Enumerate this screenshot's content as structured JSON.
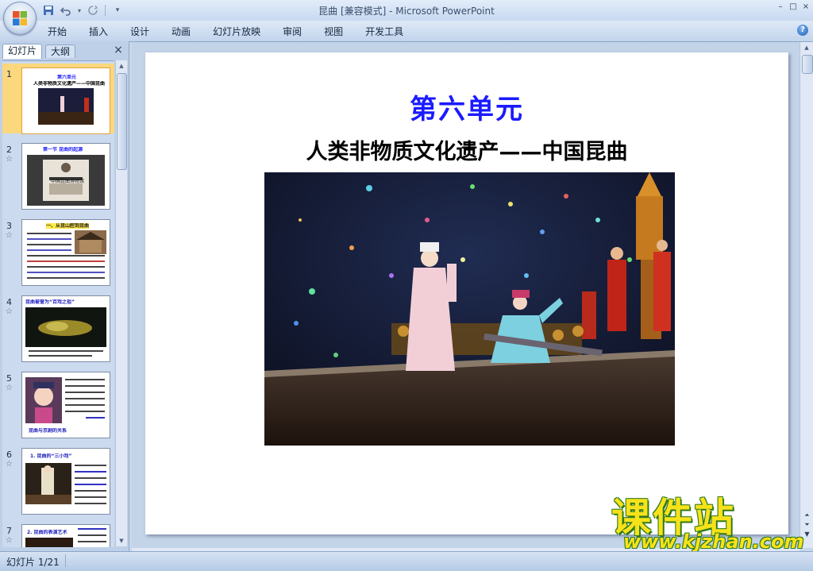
{
  "window": {
    "title": "昆曲 [兼容模式] - Microsoft PowerPoint",
    "controls": [
      "–",
      "□",
      "×"
    ]
  },
  "quick_access": [
    "save-icon",
    "undo-icon",
    "redo-icon",
    "customize-icon"
  ],
  "ribbon": {
    "tabs": [
      "开始",
      "插入",
      "设计",
      "动画",
      "幻灯片放映",
      "审阅",
      "视图",
      "开发工具"
    ],
    "help": "?"
  },
  "left_pane": {
    "tab_slides": "幻灯片",
    "tab_outline": "大纲",
    "close": "×",
    "thumbnails": [
      {
        "num": "1",
        "title": "第六单元",
        "sub": "人类非物质文化遗产——中国昆曲"
      },
      {
        "num": "2",
        "title": "第一节 昆曲的起源",
        "sub": "中国昆曲博物馆"
      },
      {
        "num": "3",
        "title": "一、从昆山腔到昆曲",
        "sub": ""
      },
      {
        "num": "4",
        "title": "昆曲被誉为“百戏之祖”",
        "sub": ""
      },
      {
        "num": "5",
        "title": "",
        "sub": "昆曲与京剧的关系"
      },
      {
        "num": "6",
        "title": "1. 昆曲的“三小戏”",
        "sub": ""
      },
      {
        "num": "7",
        "title": "2. 昆曲的表演艺术",
        "sub": ""
      }
    ]
  },
  "slide": {
    "title": "第六单元",
    "subtitle": "人类非物质文化遗产——中国昆曲"
  },
  "watermark": {
    "cn": "课件站",
    "url": "www.kjzhan.com"
  },
  "status": {
    "slide_info": "幻灯片 1/21"
  },
  "colors": {
    "title_blue": "#1a1aff",
    "selection": "#fbd77e",
    "ribbon": "#c2d4ec"
  }
}
